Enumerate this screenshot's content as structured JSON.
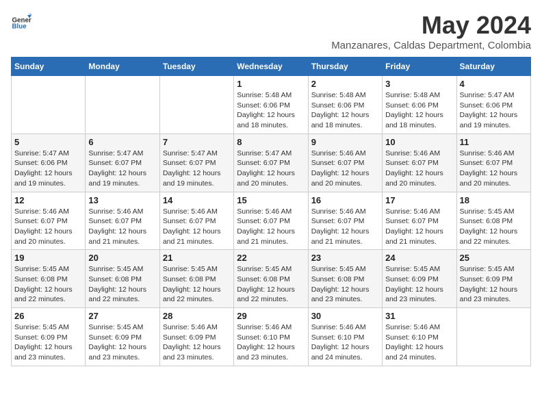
{
  "logo": {
    "general": "General",
    "blue": "Blue"
  },
  "title": {
    "month_year": "May 2024",
    "location": "Manzanares, Caldas Department, Colombia"
  },
  "calendar": {
    "headers": [
      "Sunday",
      "Monday",
      "Tuesday",
      "Wednesday",
      "Thursday",
      "Friday",
      "Saturday"
    ],
    "weeks": [
      [
        {
          "day": "",
          "info": ""
        },
        {
          "day": "",
          "info": ""
        },
        {
          "day": "",
          "info": ""
        },
        {
          "day": "1",
          "info": "Sunrise: 5:48 AM\nSunset: 6:06 PM\nDaylight: 12 hours\nand 18 minutes."
        },
        {
          "day": "2",
          "info": "Sunrise: 5:48 AM\nSunset: 6:06 PM\nDaylight: 12 hours\nand 18 minutes."
        },
        {
          "day": "3",
          "info": "Sunrise: 5:48 AM\nSunset: 6:06 PM\nDaylight: 12 hours\nand 18 minutes."
        },
        {
          "day": "4",
          "info": "Sunrise: 5:47 AM\nSunset: 6:06 PM\nDaylight: 12 hours\nand 19 minutes."
        }
      ],
      [
        {
          "day": "5",
          "info": "Sunrise: 5:47 AM\nSunset: 6:06 PM\nDaylight: 12 hours\nand 19 minutes."
        },
        {
          "day": "6",
          "info": "Sunrise: 5:47 AM\nSunset: 6:07 PM\nDaylight: 12 hours\nand 19 minutes."
        },
        {
          "day": "7",
          "info": "Sunrise: 5:47 AM\nSunset: 6:07 PM\nDaylight: 12 hours\nand 19 minutes."
        },
        {
          "day": "8",
          "info": "Sunrise: 5:47 AM\nSunset: 6:07 PM\nDaylight: 12 hours\nand 20 minutes."
        },
        {
          "day": "9",
          "info": "Sunrise: 5:46 AM\nSunset: 6:07 PM\nDaylight: 12 hours\nand 20 minutes."
        },
        {
          "day": "10",
          "info": "Sunrise: 5:46 AM\nSunset: 6:07 PM\nDaylight: 12 hours\nand 20 minutes."
        },
        {
          "day": "11",
          "info": "Sunrise: 5:46 AM\nSunset: 6:07 PM\nDaylight: 12 hours\nand 20 minutes."
        }
      ],
      [
        {
          "day": "12",
          "info": "Sunrise: 5:46 AM\nSunset: 6:07 PM\nDaylight: 12 hours\nand 20 minutes."
        },
        {
          "day": "13",
          "info": "Sunrise: 5:46 AM\nSunset: 6:07 PM\nDaylight: 12 hours\nand 21 minutes."
        },
        {
          "day": "14",
          "info": "Sunrise: 5:46 AM\nSunset: 6:07 PM\nDaylight: 12 hours\nand 21 minutes."
        },
        {
          "day": "15",
          "info": "Sunrise: 5:46 AM\nSunset: 6:07 PM\nDaylight: 12 hours\nand 21 minutes."
        },
        {
          "day": "16",
          "info": "Sunrise: 5:46 AM\nSunset: 6:07 PM\nDaylight: 12 hours\nand 21 minutes."
        },
        {
          "day": "17",
          "info": "Sunrise: 5:46 AM\nSunset: 6:07 PM\nDaylight: 12 hours\nand 21 minutes."
        },
        {
          "day": "18",
          "info": "Sunrise: 5:45 AM\nSunset: 6:08 PM\nDaylight: 12 hours\nand 22 minutes."
        }
      ],
      [
        {
          "day": "19",
          "info": "Sunrise: 5:45 AM\nSunset: 6:08 PM\nDaylight: 12 hours\nand 22 minutes."
        },
        {
          "day": "20",
          "info": "Sunrise: 5:45 AM\nSunset: 6:08 PM\nDaylight: 12 hours\nand 22 minutes."
        },
        {
          "day": "21",
          "info": "Sunrise: 5:45 AM\nSunset: 6:08 PM\nDaylight: 12 hours\nand 22 minutes."
        },
        {
          "day": "22",
          "info": "Sunrise: 5:45 AM\nSunset: 6:08 PM\nDaylight: 12 hours\nand 22 minutes."
        },
        {
          "day": "23",
          "info": "Sunrise: 5:45 AM\nSunset: 6:08 PM\nDaylight: 12 hours\nand 23 minutes."
        },
        {
          "day": "24",
          "info": "Sunrise: 5:45 AM\nSunset: 6:09 PM\nDaylight: 12 hours\nand 23 minutes."
        },
        {
          "day": "25",
          "info": "Sunrise: 5:45 AM\nSunset: 6:09 PM\nDaylight: 12 hours\nand 23 minutes."
        }
      ],
      [
        {
          "day": "26",
          "info": "Sunrise: 5:45 AM\nSunset: 6:09 PM\nDaylight: 12 hours\nand 23 minutes."
        },
        {
          "day": "27",
          "info": "Sunrise: 5:45 AM\nSunset: 6:09 PM\nDaylight: 12 hours\nand 23 minutes."
        },
        {
          "day": "28",
          "info": "Sunrise: 5:46 AM\nSunset: 6:09 PM\nDaylight: 12 hours\nand 23 minutes."
        },
        {
          "day": "29",
          "info": "Sunrise: 5:46 AM\nSunset: 6:10 PM\nDaylight: 12 hours\nand 23 minutes."
        },
        {
          "day": "30",
          "info": "Sunrise: 5:46 AM\nSunset: 6:10 PM\nDaylight: 12 hours\nand 24 minutes."
        },
        {
          "day": "31",
          "info": "Sunrise: 5:46 AM\nSunset: 6:10 PM\nDaylight: 12 hours\nand 24 minutes."
        },
        {
          "day": "",
          "info": ""
        }
      ]
    ]
  }
}
